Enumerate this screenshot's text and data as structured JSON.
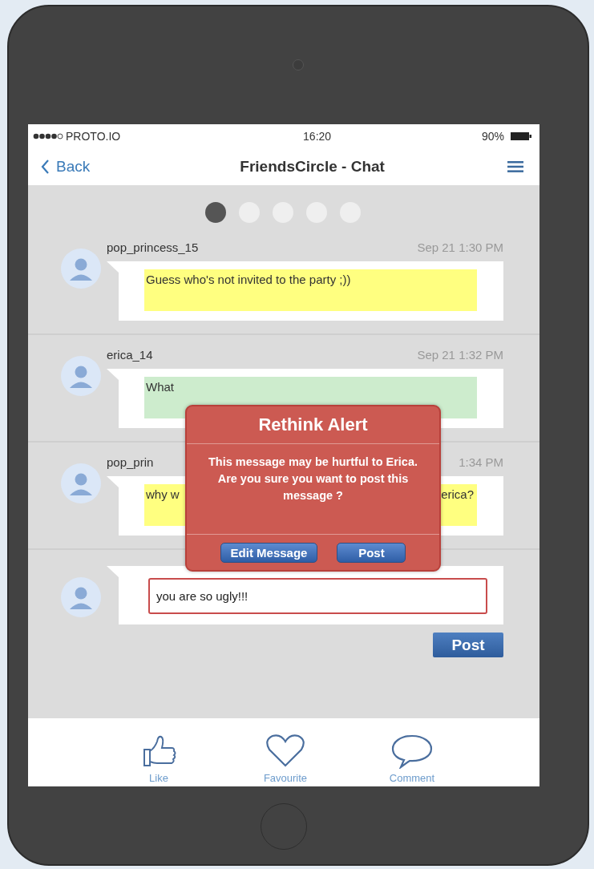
{
  "status_bar": {
    "carrier": "PROTO.IO",
    "time": "16:20",
    "battery": "90%"
  },
  "nav": {
    "back": "Back",
    "title": "FriendsCircle - Chat"
  },
  "pages": [
    {
      "selected": true
    },
    {
      "selected": false
    },
    {
      "selected": false
    },
    {
      "selected": false
    },
    {
      "selected": false
    }
  ],
  "messages": [
    {
      "user": "pop_princess_15",
      "time": "Sep 21 1:30 PM",
      "text": "Guess who's not invited to the party ;))",
      "color": "#ffff80"
    },
    {
      "user": "erica_14",
      "time": "Sep 21 1:32 PM",
      "text": "What",
      "color": "#cdeccd"
    },
    {
      "user": "pop_prin",
      "time": "1:34 PM",
      "text": "why w",
      "text_right": "erica?",
      "color": "#ffff80"
    }
  ],
  "composer": {
    "value": "you are so ugly!!!",
    "post": "Post"
  },
  "alert": {
    "title": "Rethink Alert",
    "message": "This message may be hurtful to Erica. Are you sure you want to post this message ?",
    "buttons": [
      "Edit Message",
      "Post"
    ]
  },
  "tabs": [
    {
      "kind": "like",
      "label": "Like"
    },
    {
      "kind": "favourite",
      "label": "Favourite"
    },
    {
      "kind": "comment",
      "label": "Comment"
    }
  ]
}
